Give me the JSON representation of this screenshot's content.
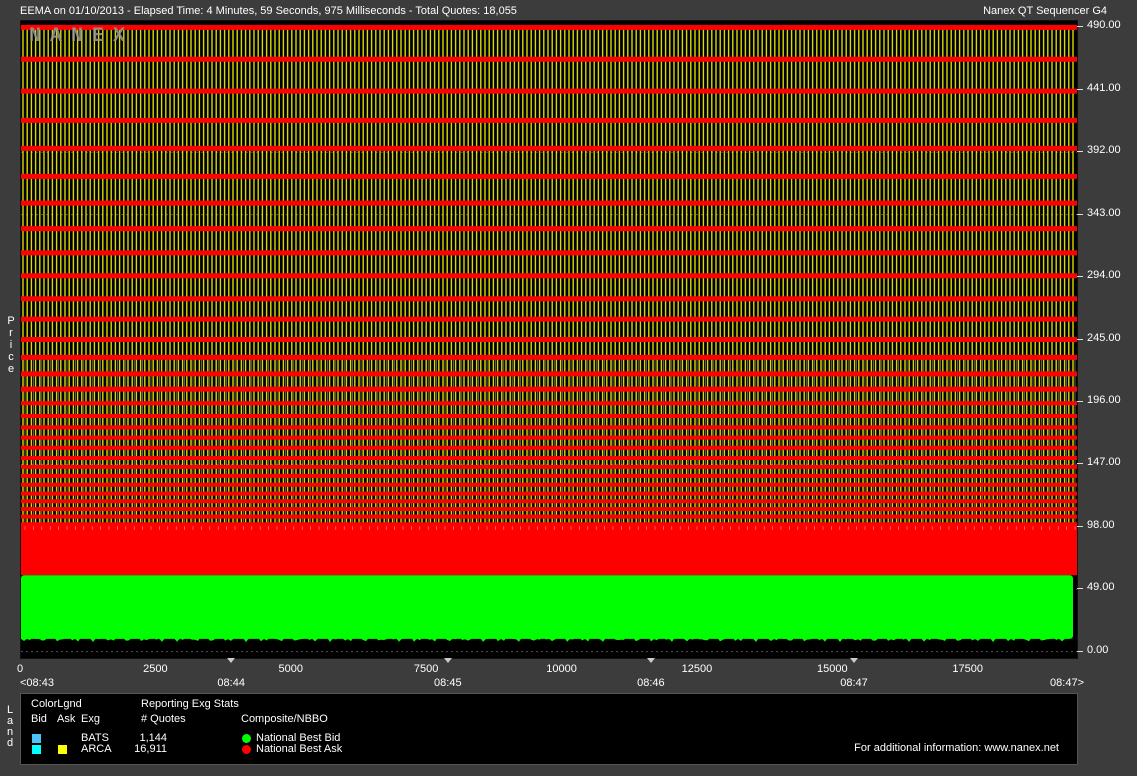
{
  "header": {
    "left": "EEMA on 01/10/2013  -  Elapsed Time: 4 Minutes, 59 Seconds, 975 Milliseconds  -  Total Quotes: 18,055",
    "right": "Nanex QT Sequencer G4"
  },
  "watermark": "NANEX",
  "colors": {
    "background": "#3c3c3c",
    "plot": "#000000",
    "bid": "#00ff00",
    "ask": "#ff0000",
    "arca_ask": "#ffff00",
    "bats": "#4fc3f7",
    "arca_bid": "#00ffff"
  },
  "chart_data": {
    "type": "scatter",
    "title": "",
    "xlabel": "",
    "ylabel": "Price",
    "xlim": [
      0,
      19500
    ],
    "ylim": [
      -5,
      495
    ],
    "grid": true,
    "y_ticks": [
      "0.00",
      "49.00",
      "98.00",
      "147.00",
      "196.00",
      "245.00",
      "294.00",
      "343.00",
      "392.00",
      "441.00",
      "490.00"
    ],
    "y_tick_values": [
      0,
      49,
      98,
      147,
      196,
      245,
      294,
      343,
      392,
      441,
      490
    ],
    "x_ticks": [
      "0",
      "2500",
      "5000",
      "7500",
      "10000",
      "12500",
      "15000",
      "17500"
    ],
    "x_tick_values": [
      0,
      2500,
      5000,
      7500,
      10000,
      12500,
      15000,
      17500
    ],
    "time_labels": [
      {
        "label": "<08:43",
        "x": 0
      },
      {
        "label": "08:44",
        "x": 3900
      },
      {
        "label": "08:45",
        "x": 7900
      },
      {
        "label": "08:46",
        "x": 11650
      },
      {
        "label": "08:47",
        "x": 15400
      },
      {
        "label": "08:47>",
        "x": 19500
      }
    ],
    "series": [
      {
        "name": "National Best Bid",
        "color": "#00ff00",
        "band": [
          10,
          60
        ]
      },
      {
        "name": "National Best Ask",
        "color": "#ff0000",
        "band": [
          60,
          490
        ]
      },
      {
        "name": "ARCA",
        "color": "#ffff00",
        "band": [
          60,
          490
        ]
      }
    ],
    "ask_levels": [
      490,
      465,
      440,
      417,
      395,
      373,
      352,
      332,
      313,
      295,
      277,
      261,
      245,
      231,
      218,
      206,
      195,
      185,
      176,
      168,
      160,
      152,
      145,
      138,
      131,
      124,
      118,
      112,
      106,
      100,
      94,
      88,
      82,
      76,
      70,
      64
    ]
  },
  "legend": {
    "side_label": "Land",
    "color_legend": "ColorLgnd",
    "col_bid": "Bid",
    "col_ask": "Ask",
    "col_exg": "Exg",
    "reporting": "Reporting Exg Stats",
    "quotes_header": "# Quotes",
    "composite": "Composite/NBBO",
    "exchanges": [
      {
        "name": "BATS",
        "quotes": "1,144"
      },
      {
        "name": "ARCA",
        "quotes": "16,911"
      }
    ],
    "nbbo": [
      {
        "label": "National Best Bid"
      },
      {
        "label": "National Best Ask"
      }
    ],
    "info": "For additional information: www.nanex.net"
  }
}
